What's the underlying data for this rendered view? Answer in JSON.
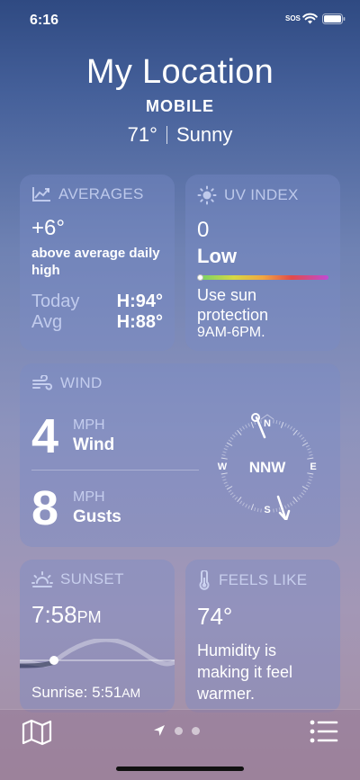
{
  "status": {
    "time": "6:16",
    "sos": "SOS"
  },
  "header": {
    "title": "My Location",
    "subtitle": "MOBILE",
    "temp": "71°",
    "condition": "Sunny"
  },
  "averages": {
    "title": "AVERAGES",
    "value": "+6°",
    "description": "above average daily high",
    "rows": [
      {
        "label": "Today",
        "value": "H:94°"
      },
      {
        "label": "Avg",
        "value": "H:88°"
      }
    ]
  },
  "uv": {
    "title": "UV INDEX",
    "value": "0",
    "level": "Low",
    "level_fraction": 0,
    "description": "Use sun protection",
    "hours": "9AM-6PM."
  },
  "wind": {
    "title": "WIND",
    "speed": "4",
    "speed_unit": "MPH",
    "speed_label": "Wind",
    "gusts": "8",
    "gusts_unit": "MPH",
    "gusts_label": "Gusts",
    "direction": "NNW",
    "compass": {
      "n": "N",
      "e": "E",
      "s": "S",
      "w": "W"
    }
  },
  "sunset": {
    "title": "SUNSET",
    "time": "7:58",
    "time_suffix": "PM",
    "sunrise_label": "Sunrise: 5:51",
    "sunrise_suffix": "AM"
  },
  "feels_like": {
    "title": "FEELS LIKE",
    "value": "74°",
    "description": "Humidity is making it feel warmer."
  },
  "icons": {
    "averages": "trend-chart-icon",
    "uv": "sun-icon",
    "wind": "wind-icon",
    "sunset": "sunset-icon",
    "feels_like": "thermometer-icon",
    "map": "map-icon",
    "location": "location-arrow-icon",
    "list": "list-icon"
  }
}
